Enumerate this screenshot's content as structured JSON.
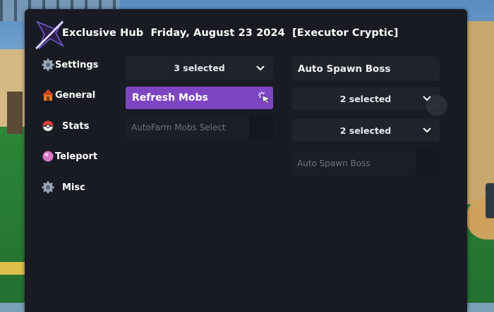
{
  "header": {
    "title": "Exclusive Hub  Friday, August 23 2024  [Executor Cryptic]",
    "logo_icon": "star-slash-logo"
  },
  "sidebar": {
    "items": [
      {
        "label": "Settings",
        "icon": "gear-icon"
      },
      {
        "label": "General",
        "icon": "house-icon"
      },
      {
        "label": "Stats",
        "icon": "pokeball-icon"
      },
      {
        "label": "Teleport",
        "icon": "pink-orb-icon"
      },
      {
        "label": "Misc",
        "icon": "gear-icon"
      }
    ]
  },
  "left_column": {
    "mobs_dropdown": {
      "value": "3 selected"
    },
    "refresh_button": {
      "label": "Refresh Mobs"
    },
    "autofarm_input": {
      "placeholder": "AutoFarm Mobs Select"
    }
  },
  "right_column": {
    "boss_title": "Auto Spawn Boss",
    "dropdown_1": {
      "value": "2 selected"
    },
    "dropdown_2": {
      "value": "2 selected"
    },
    "boss_input": {
      "placeholder": "Auto Spawn Boss"
    }
  },
  "colors": {
    "panel_bg": "#181b23",
    "control_bg": "#1f232c",
    "accent_purple": "#7d45c2",
    "text": "#ffffff"
  }
}
